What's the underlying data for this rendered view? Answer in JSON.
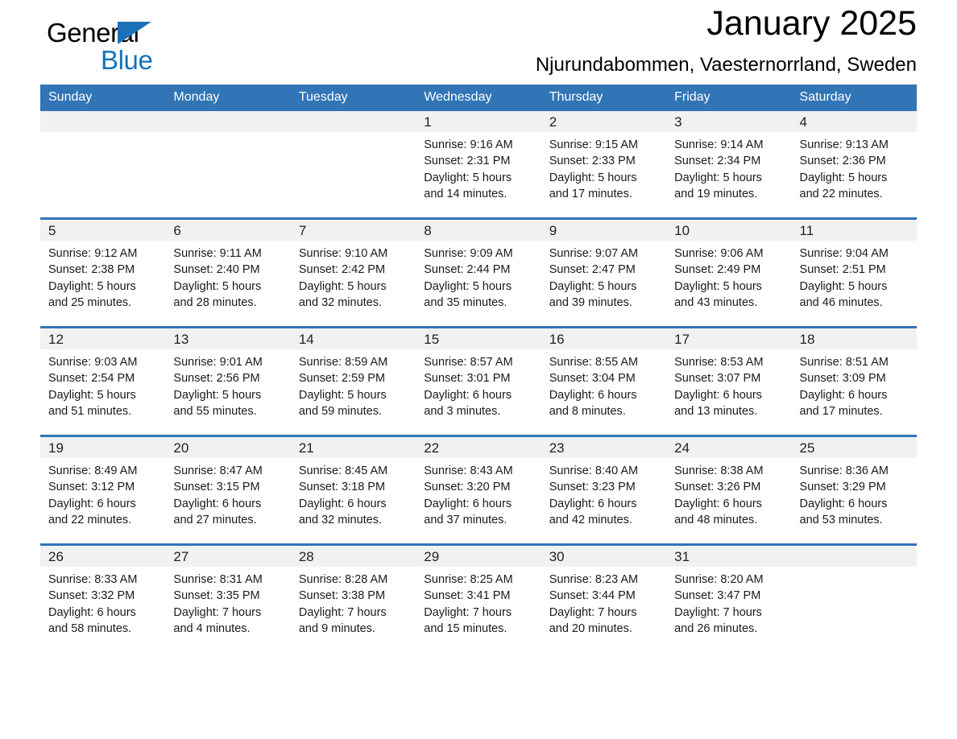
{
  "brand": {
    "name_part1": "General",
    "name_part2": "Blue",
    "logo_icon": "triangle-flag-icon",
    "accent_color": "#1273bb"
  },
  "header": {
    "month_title": "January 2025",
    "location": "Njurundabommen, Vaesternorrland, Sweden"
  },
  "theme": {
    "header_blue": "#3275b6",
    "daynum_band": "#f1f1f1",
    "cell_bg": "#ffffff"
  },
  "weekday_headers": [
    "Sunday",
    "Monday",
    "Tuesday",
    "Wednesday",
    "Thursday",
    "Friday",
    "Saturday"
  ],
  "weeks": [
    [
      {
        "day": "",
        "sunrise": "",
        "sunset": "",
        "daylight_line1": "",
        "daylight_line2": ""
      },
      {
        "day": "",
        "sunrise": "",
        "sunset": "",
        "daylight_line1": "",
        "daylight_line2": ""
      },
      {
        "day": "",
        "sunrise": "",
        "sunset": "",
        "daylight_line1": "",
        "daylight_line2": ""
      },
      {
        "day": "1",
        "sunrise": "Sunrise: 9:16 AM",
        "sunset": "Sunset: 2:31 PM",
        "daylight_line1": "Daylight: 5 hours",
        "daylight_line2": "and 14 minutes."
      },
      {
        "day": "2",
        "sunrise": "Sunrise: 9:15 AM",
        "sunset": "Sunset: 2:33 PM",
        "daylight_line1": "Daylight: 5 hours",
        "daylight_line2": "and 17 minutes."
      },
      {
        "day": "3",
        "sunrise": "Sunrise: 9:14 AM",
        "sunset": "Sunset: 2:34 PM",
        "daylight_line1": "Daylight: 5 hours",
        "daylight_line2": "and 19 minutes."
      },
      {
        "day": "4",
        "sunrise": "Sunrise: 9:13 AM",
        "sunset": "Sunset: 2:36 PM",
        "daylight_line1": "Daylight: 5 hours",
        "daylight_line2": "and 22 minutes."
      }
    ],
    [
      {
        "day": "5",
        "sunrise": "Sunrise: 9:12 AM",
        "sunset": "Sunset: 2:38 PM",
        "daylight_line1": "Daylight: 5 hours",
        "daylight_line2": "and 25 minutes."
      },
      {
        "day": "6",
        "sunrise": "Sunrise: 9:11 AM",
        "sunset": "Sunset: 2:40 PM",
        "daylight_line1": "Daylight: 5 hours",
        "daylight_line2": "and 28 minutes."
      },
      {
        "day": "7",
        "sunrise": "Sunrise: 9:10 AM",
        "sunset": "Sunset: 2:42 PM",
        "daylight_line1": "Daylight: 5 hours",
        "daylight_line2": "and 32 minutes."
      },
      {
        "day": "8",
        "sunrise": "Sunrise: 9:09 AM",
        "sunset": "Sunset: 2:44 PM",
        "daylight_line1": "Daylight: 5 hours",
        "daylight_line2": "and 35 minutes."
      },
      {
        "day": "9",
        "sunrise": "Sunrise: 9:07 AM",
        "sunset": "Sunset: 2:47 PM",
        "daylight_line1": "Daylight: 5 hours",
        "daylight_line2": "and 39 minutes."
      },
      {
        "day": "10",
        "sunrise": "Sunrise: 9:06 AM",
        "sunset": "Sunset: 2:49 PM",
        "daylight_line1": "Daylight: 5 hours",
        "daylight_line2": "and 43 minutes."
      },
      {
        "day": "11",
        "sunrise": "Sunrise: 9:04 AM",
        "sunset": "Sunset: 2:51 PM",
        "daylight_line1": "Daylight: 5 hours",
        "daylight_line2": "and 46 minutes."
      }
    ],
    [
      {
        "day": "12",
        "sunrise": "Sunrise: 9:03 AM",
        "sunset": "Sunset: 2:54 PM",
        "daylight_line1": "Daylight: 5 hours",
        "daylight_line2": "and 51 minutes."
      },
      {
        "day": "13",
        "sunrise": "Sunrise: 9:01 AM",
        "sunset": "Sunset: 2:56 PM",
        "daylight_line1": "Daylight: 5 hours",
        "daylight_line2": "and 55 minutes."
      },
      {
        "day": "14",
        "sunrise": "Sunrise: 8:59 AM",
        "sunset": "Sunset: 2:59 PM",
        "daylight_line1": "Daylight: 5 hours",
        "daylight_line2": "and 59 minutes."
      },
      {
        "day": "15",
        "sunrise": "Sunrise: 8:57 AM",
        "sunset": "Sunset: 3:01 PM",
        "daylight_line1": "Daylight: 6 hours",
        "daylight_line2": "and 3 minutes."
      },
      {
        "day": "16",
        "sunrise": "Sunrise: 8:55 AM",
        "sunset": "Sunset: 3:04 PM",
        "daylight_line1": "Daylight: 6 hours",
        "daylight_line2": "and 8 minutes."
      },
      {
        "day": "17",
        "sunrise": "Sunrise: 8:53 AM",
        "sunset": "Sunset: 3:07 PM",
        "daylight_line1": "Daylight: 6 hours",
        "daylight_line2": "and 13 minutes."
      },
      {
        "day": "18",
        "sunrise": "Sunrise: 8:51 AM",
        "sunset": "Sunset: 3:09 PM",
        "daylight_line1": "Daylight: 6 hours",
        "daylight_line2": "and 17 minutes."
      }
    ],
    [
      {
        "day": "19",
        "sunrise": "Sunrise: 8:49 AM",
        "sunset": "Sunset: 3:12 PM",
        "daylight_line1": "Daylight: 6 hours",
        "daylight_line2": "and 22 minutes."
      },
      {
        "day": "20",
        "sunrise": "Sunrise: 8:47 AM",
        "sunset": "Sunset: 3:15 PM",
        "daylight_line1": "Daylight: 6 hours",
        "daylight_line2": "and 27 minutes."
      },
      {
        "day": "21",
        "sunrise": "Sunrise: 8:45 AM",
        "sunset": "Sunset: 3:18 PM",
        "daylight_line1": "Daylight: 6 hours",
        "daylight_line2": "and 32 minutes."
      },
      {
        "day": "22",
        "sunrise": "Sunrise: 8:43 AM",
        "sunset": "Sunset: 3:20 PM",
        "daylight_line1": "Daylight: 6 hours",
        "daylight_line2": "and 37 minutes."
      },
      {
        "day": "23",
        "sunrise": "Sunrise: 8:40 AM",
        "sunset": "Sunset: 3:23 PM",
        "daylight_line1": "Daylight: 6 hours",
        "daylight_line2": "and 42 minutes."
      },
      {
        "day": "24",
        "sunrise": "Sunrise: 8:38 AM",
        "sunset": "Sunset: 3:26 PM",
        "daylight_line1": "Daylight: 6 hours",
        "daylight_line2": "and 48 minutes."
      },
      {
        "day": "25",
        "sunrise": "Sunrise: 8:36 AM",
        "sunset": "Sunset: 3:29 PM",
        "daylight_line1": "Daylight: 6 hours",
        "daylight_line2": "and 53 minutes."
      }
    ],
    [
      {
        "day": "26",
        "sunrise": "Sunrise: 8:33 AM",
        "sunset": "Sunset: 3:32 PM",
        "daylight_line1": "Daylight: 6 hours",
        "daylight_line2": "and 58 minutes."
      },
      {
        "day": "27",
        "sunrise": "Sunrise: 8:31 AM",
        "sunset": "Sunset: 3:35 PM",
        "daylight_line1": "Daylight: 7 hours",
        "daylight_line2": "and 4 minutes."
      },
      {
        "day": "28",
        "sunrise": "Sunrise: 8:28 AM",
        "sunset": "Sunset: 3:38 PM",
        "daylight_line1": "Daylight: 7 hours",
        "daylight_line2": "and 9 minutes."
      },
      {
        "day": "29",
        "sunrise": "Sunrise: 8:25 AM",
        "sunset": "Sunset: 3:41 PM",
        "daylight_line1": "Daylight: 7 hours",
        "daylight_line2": "and 15 minutes."
      },
      {
        "day": "30",
        "sunrise": "Sunrise: 8:23 AM",
        "sunset": "Sunset: 3:44 PM",
        "daylight_line1": "Daylight: 7 hours",
        "daylight_line2": "and 20 minutes."
      },
      {
        "day": "31",
        "sunrise": "Sunrise: 8:20 AM",
        "sunset": "Sunset: 3:47 PM",
        "daylight_line1": "Daylight: 7 hours",
        "daylight_line2": "and 26 minutes."
      },
      {
        "day": "",
        "sunrise": "",
        "sunset": "",
        "daylight_line1": "",
        "daylight_line2": ""
      }
    ]
  ]
}
